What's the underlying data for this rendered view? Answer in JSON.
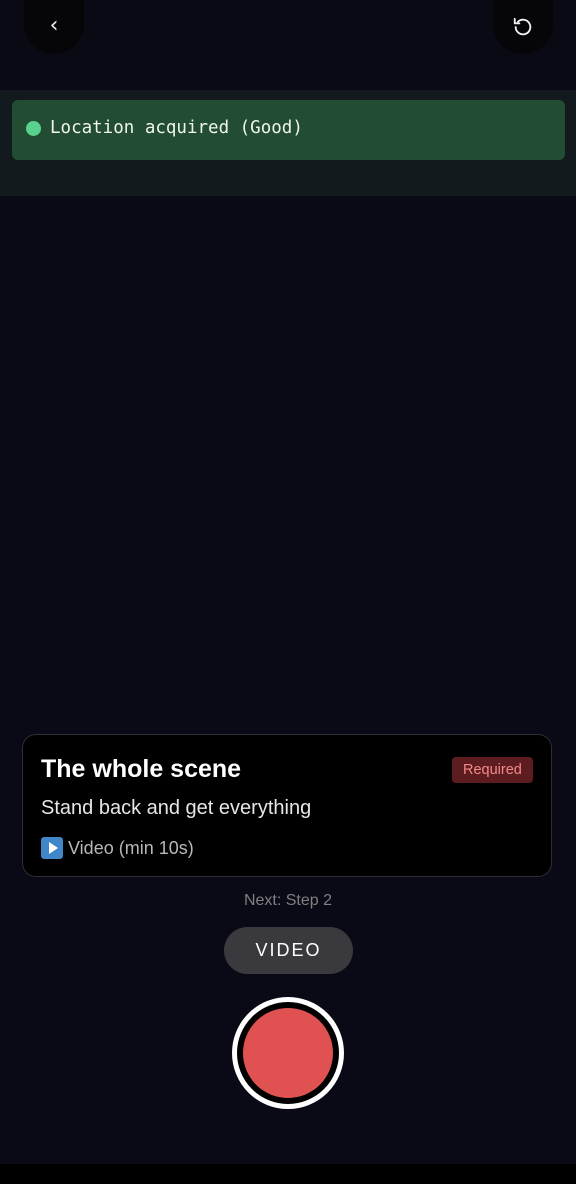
{
  "header": {
    "back_icon": "chevron-left-icon",
    "refresh_icon": "rotate-ccw-icon"
  },
  "status": {
    "text": "Location acquired (Good)",
    "dot_color": "#58d38f",
    "background_color": "#234d32"
  },
  "card": {
    "title": "The whole scene",
    "badge": "Required",
    "subtitle": "Stand back and get everything",
    "media_icon": "play-button-icon",
    "media_label": "Video (min 10s)"
  },
  "next_step": "Next: Step 2",
  "mode_button": "VIDEO",
  "shutter": {
    "color": "#e05252"
  }
}
